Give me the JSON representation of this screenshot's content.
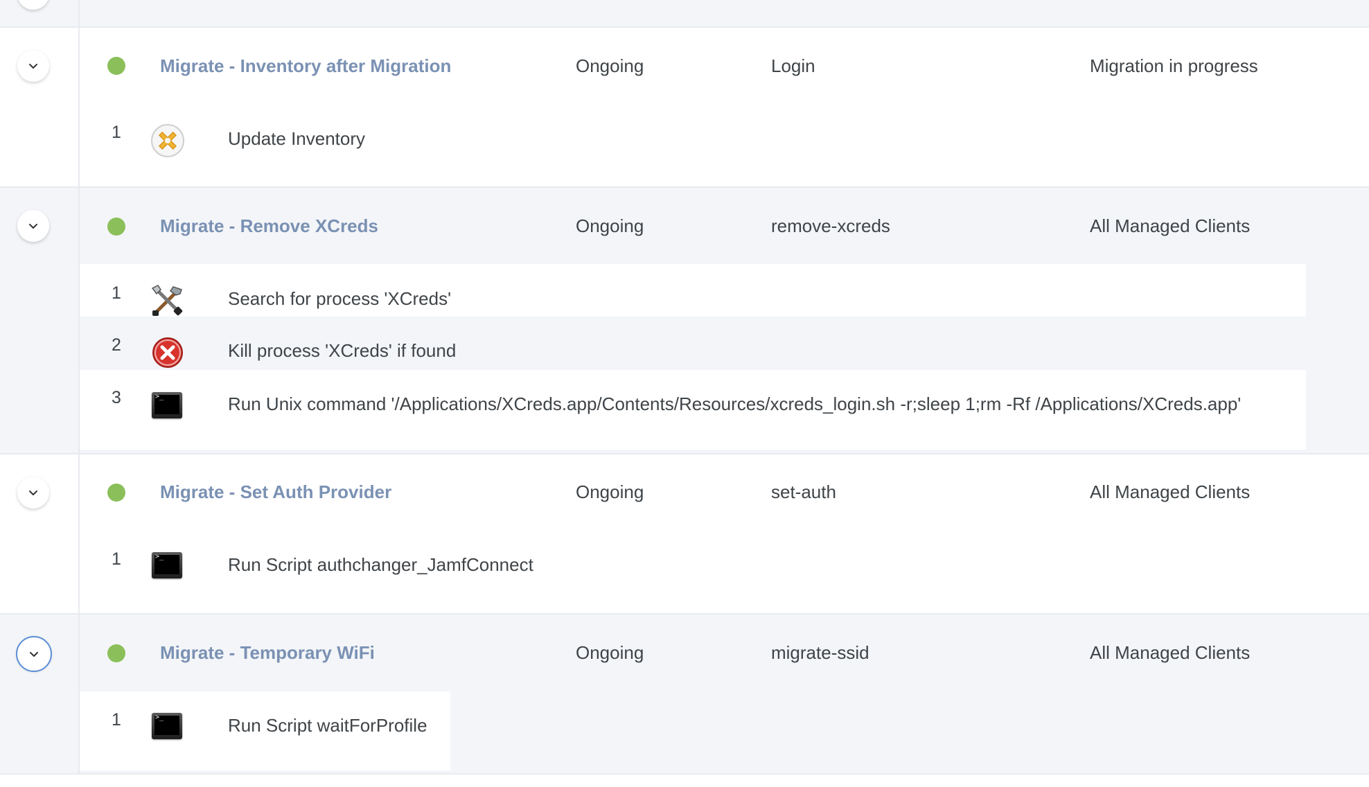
{
  "colors": {
    "policy_link": "#7a91b3",
    "status_enabled": "#8bbf5a",
    "active_toggle_ring": "#5b8fd6",
    "band_gray": "#f3f5f8"
  },
  "policies": [
    {
      "name": "Migrate - Inventory after Migration",
      "frequency": "Ongoing",
      "trigger": "Login",
      "scope": "Migration in progress",
      "status_icon": "green-dot",
      "steps": [
        {
          "num": "1",
          "icon": "inventory-icon",
          "text": "Update Inventory"
        }
      ]
    },
    {
      "name": "Migrate - Remove XCreds",
      "frequency": "Ongoing",
      "trigger": "remove-xcreds",
      "scope": "All Managed Clients",
      "status_icon": "green-dot",
      "steps": [
        {
          "num": "1",
          "icon": "tools-icon",
          "text": "Search for process 'XCreds'"
        },
        {
          "num": "2",
          "icon": "kill-process-icon",
          "text": "Kill process 'XCreds' if found"
        },
        {
          "num": "3",
          "icon": "terminal-icon",
          "text": "Run Unix command '/Applications/XCreds.app/Contents/Resources/xcreds_login.sh -r;sleep 1;rm -Rf /Applications/XCreds.app'"
        }
      ]
    },
    {
      "name": "Migrate - Set Auth Provider",
      "frequency": "Ongoing",
      "trigger": "set-auth",
      "scope": "All Managed Clients",
      "status_icon": "green-dot",
      "steps": [
        {
          "num": "1",
          "icon": "terminal-icon",
          "text": "Run Script authchanger_JamfConnect"
        }
      ]
    },
    {
      "name": "Migrate - Temporary WiFi",
      "frequency": "Ongoing",
      "trigger": "migrate-ssid",
      "scope": "All Managed Clients",
      "status_icon": "green-dot",
      "steps": [
        {
          "num": "1",
          "icon": "terminal-icon",
          "text": "Run Script waitForProfile"
        }
      ]
    }
  ]
}
